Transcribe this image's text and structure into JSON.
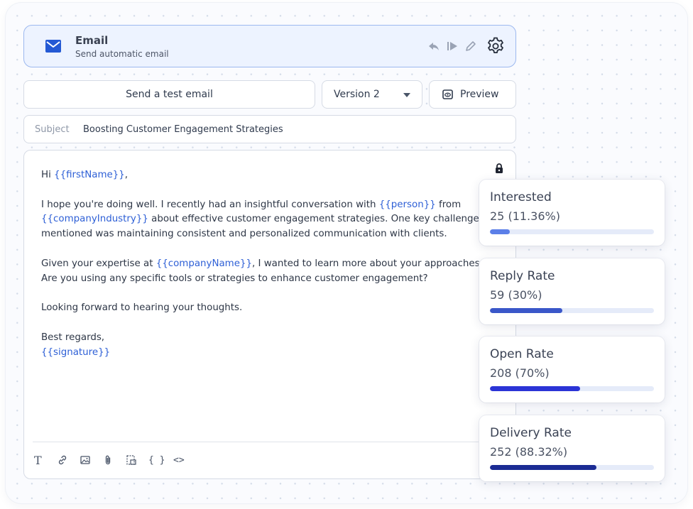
{
  "header": {
    "title": "Email",
    "subtitle": "Send automatic email",
    "icons": [
      "mail-icon",
      "reply-icon",
      "skip-icon",
      "pencil-icon",
      "gear-icon"
    ]
  },
  "actions": {
    "test_email_label": "Send a test email",
    "version_selected": "Version 2",
    "preview_label": "Preview"
  },
  "subject": {
    "label": "Subject",
    "value": "Boosting Customer Engagement Strategies"
  },
  "body": {
    "greeting_prefix": "Hi ",
    "greeting_var": "{{firstName}}",
    "greeting_suffix": ",",
    "p1_a": "I hope you're doing well. I recently had an insightful conversation with ",
    "p1_var1": "{{person}}",
    "p1_b": " from",
    "p1_var2": "{{companyIndustry}}",
    "p1_c": " about effective customer engagement strategies. One key challenge",
    "p1_d": "mentioned was maintaining consistent and personalized communication with clients.",
    "p2_a": "Given your expertise at ",
    "p2_var": "{{companyName}}",
    "p2_b": ", I wanted to learn more about your approaches.",
    "p2_c": "Are you using any specific tools or strategies to enhance customer engagement?",
    "p3": "Looking forward to hearing your thoughts.",
    "closing": "Best regards,",
    "signature_var": "{{signature}}"
  },
  "toolbar": {
    "text_glyph": "T",
    "braces_glyph": "{ }",
    "code_glyph": "<>"
  },
  "stats": [
    {
      "title": "Interested",
      "value": "25 (11.36%)",
      "fraction": 0.12,
      "color": "#5b7fe8"
    },
    {
      "title": "Reply Rate",
      "value": "59 (30%)",
      "fraction": 0.44,
      "color": "#3a57c9"
    },
    {
      "title": "Open Rate",
      "value": "208 (70%)",
      "fraction": 0.55,
      "color": "#2b34d6"
    },
    {
      "title": "Delivery Rate",
      "value": "252 (88.32%)",
      "fraction": 0.65,
      "color": "#1b2b94"
    }
  ]
}
